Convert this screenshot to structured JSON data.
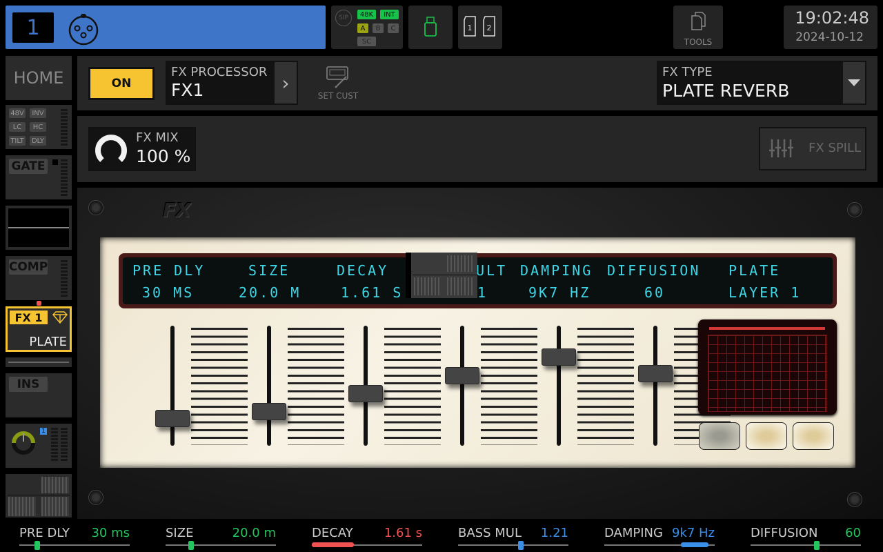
{
  "channel": {
    "number": "1",
    "input_icon": "xlr-icon",
    "color": "#3f75c8"
  },
  "status": {
    "sip_label": "SIP",
    "rate": "48K",
    "clock": "INT",
    "buses": [
      "A",
      "B",
      "C"
    ],
    "sc_label": "SC",
    "usb_icon": "usb-drive-icon",
    "sd_cards": [
      "1",
      "2"
    ]
  },
  "tools": {
    "label": "TOOLS",
    "icon": "copy-icon"
  },
  "clock": {
    "time": "19:02:48",
    "date": "2024-10-12"
  },
  "sidebar": {
    "home_label": "HOME",
    "input_tags": [
      "48V",
      "INV",
      "LC",
      "HC",
      "TILT",
      "DLY"
    ],
    "gate_label": "GATE",
    "comp_label": "COMP",
    "fx_slot": {
      "label": "FX 1",
      "type": "PLATE"
    },
    "ins_label": "INS",
    "bus_number": "1"
  },
  "header": {
    "on_label": "ON",
    "processor_label": "FX PROCESSOR",
    "processor_value": "FX1",
    "set_cust_label": "SET CUST",
    "fx_type_label": "FX TYPE",
    "fx_type_value": "PLATE REVERB"
  },
  "mix": {
    "label": "FX MIX",
    "value": "100 %",
    "spill_label": "FX SPILL"
  },
  "lcd": {
    "top_row": [
      "PRE DLY",
      "SIZE",
      "DECAY",
      "ULT",
      "DAMPING",
      "DIFFUSION",
      "PLATE"
    ],
    "bottom_row": [
      "30 MS",
      "20.0 M",
      "1.61 S",
      "1",
      "9K7 HZ",
      "60",
      "LAYER 1"
    ]
  },
  "faders": [
    {
      "name": "pre-dly",
      "level": 0.18
    },
    {
      "name": "size",
      "level": 0.25
    },
    {
      "name": "decay",
      "level": 0.42
    },
    {
      "name": "bass-mul",
      "level": 0.6
    },
    {
      "name": "damping",
      "level": 0.78
    },
    {
      "name": "diffusion",
      "level": 0.62
    }
  ],
  "params": [
    {
      "name": "PRE DLY",
      "value": "30 ms",
      "color": "#22c55e",
      "level": 0.16,
      "style": "knob"
    },
    {
      "name": "SIZE",
      "value": "20.0 m",
      "color": "#22c55e",
      "level": 0.23,
      "style": "knob"
    },
    {
      "name": "DECAY",
      "value": "1.61 s",
      "color": "#f05252",
      "level": 0.38,
      "style": "fill"
    },
    {
      "name": "BASS MUL",
      "value": "1.21",
      "color": "#3b8ee8",
      "level": 0.57,
      "style": "knob"
    },
    {
      "name": "DAMPING",
      "value": "9k7 Hz",
      "color": "#3b8ee8",
      "level": 0.82,
      "style": "bar"
    },
    {
      "name": "DIFFUSION",
      "value": "60",
      "color": "#22c55e",
      "level": 0.6,
      "style": "knob"
    }
  ]
}
